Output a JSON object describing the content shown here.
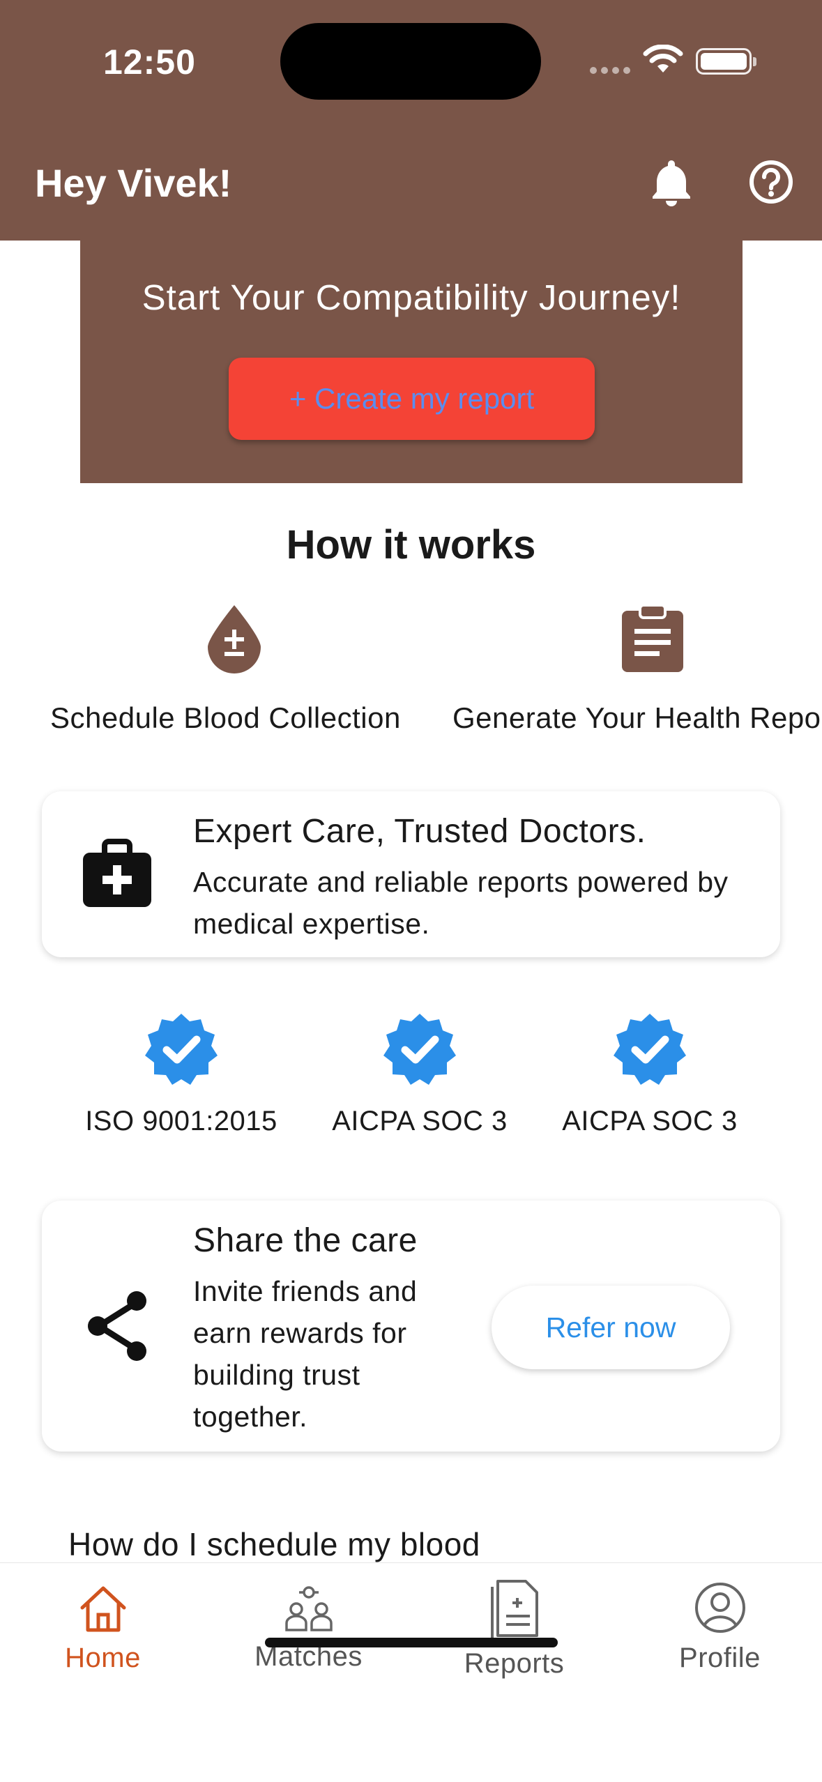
{
  "status_bar": {
    "time": "12:50"
  },
  "header": {
    "greeting": "Hey Vivek!",
    "bell_icon": "bell-icon",
    "help_icon": "help-icon"
  },
  "hero": {
    "title": "Start Your Compatibility Journey!",
    "button_label": "+ Create my report"
  },
  "how_it_works": {
    "title": "How it works",
    "steps": [
      {
        "label": "Schedule Blood Collection",
        "icon": "blood-drop-icon"
      },
      {
        "label": "Generate Your Health Report",
        "icon": "clipboard-icon"
      }
    ]
  },
  "expert_card": {
    "title": "Expert Care, Trusted Doctors.",
    "body": "Accurate and reliable reports powered by medical expertise.",
    "icon": "medical-kit-icon"
  },
  "certifications": [
    {
      "label": "ISO 9001:2015"
    },
    {
      "label": "AICPA SOC 3"
    },
    {
      "label": "AICPA SOC 3"
    }
  ],
  "share_card": {
    "title": "Share the care",
    "body": "Invite friends and earn rewards for building trust together.",
    "button_label": "Refer now",
    "icon": "share-icon"
  },
  "faq": {
    "question": "How do I schedule my blood"
  },
  "tabbar": {
    "tabs": [
      {
        "label": "Home",
        "active": true
      },
      {
        "label": "Matches",
        "active": false
      },
      {
        "label": "Reports",
        "active": false
      },
      {
        "label": "Profile",
        "active": false
      }
    ]
  },
  "colors": {
    "brand": "#7A5548",
    "cta": "#F44336",
    "accent": "#D0531E",
    "verified": "#2B8FE8"
  }
}
